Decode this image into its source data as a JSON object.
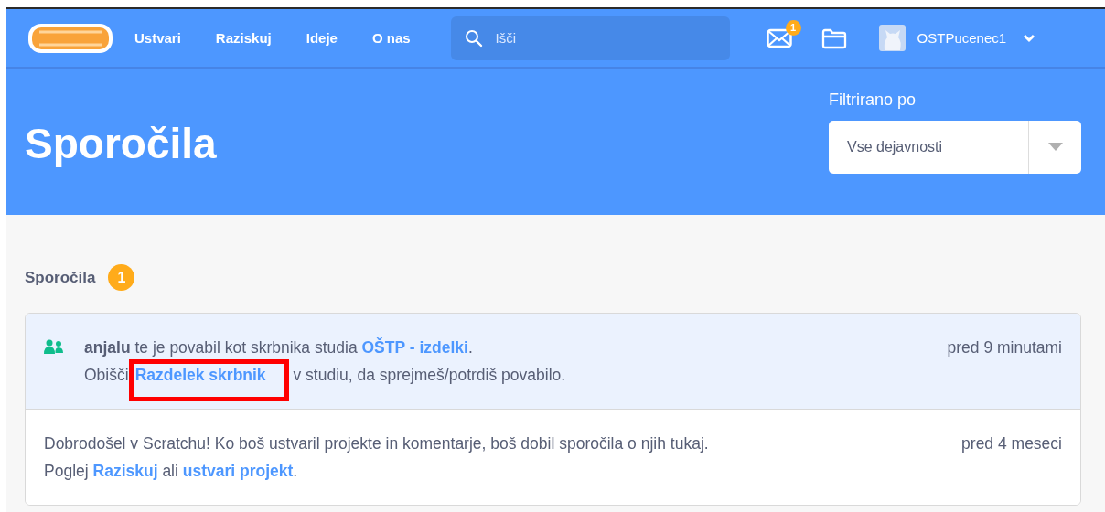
{
  "nav": {
    "items": [
      "Ustvari",
      "Raziskuj",
      "Ideje",
      "O nas"
    ],
    "search": {
      "placeholder": "Išči"
    },
    "messages_badge": "1",
    "username": "OSTPucenec1"
  },
  "header": {
    "title": "Sporočila",
    "filter_label": "Filtrirano po",
    "filter_value": "Vse dejavnosti"
  },
  "section": {
    "title": "Sporočila",
    "count": "1"
  },
  "messages": [
    {
      "unread": true,
      "kind": "invitation",
      "time": "pred 9 minutami",
      "segments": [
        {
          "kind": "bold",
          "text": "anjalu"
        },
        {
          "kind": "text",
          "text": " te je povabil kot skrbnika studia "
        },
        {
          "kind": "link",
          "text": "OŠTP - izdelki"
        },
        {
          "kind": "text",
          "text": ". Obišči"
        },
        {
          "kind": "link",
          "text": "Razdelek skrbnik",
          "annotated": true
        },
        {
          "kind": "text",
          "text": " v studiu, da sprejmeš/potrdiš povabilo."
        }
      ]
    },
    {
      "unread": false,
      "kind": "welcome",
      "time": "pred 4 meseci",
      "segments": [
        {
          "kind": "text",
          "text": "Dobrodošel v Scratchu! Ko boš ustvaril projekte in komentarje, boš dobil sporočila o njih tukaj. Poglej "
        },
        {
          "kind": "link",
          "text": "Raziskuj"
        },
        {
          "kind": "text",
          "text": " ali "
        },
        {
          "kind": "link",
          "text": "ustvari projekt"
        },
        {
          "kind": "text",
          "text": "."
        }
      ]
    }
  ]
}
